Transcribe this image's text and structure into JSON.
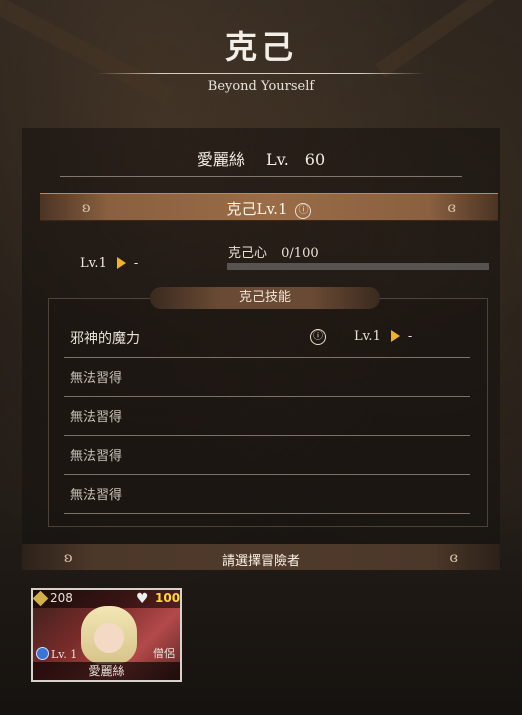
{
  "header": {
    "title": "克己",
    "subtitle": "Beyond Yourself"
  },
  "character": {
    "name": "愛麗絲",
    "level_label": "Lv.",
    "level": "60"
  },
  "transcend": {
    "title": "克己Lv.1",
    "current_level": "Lv.1",
    "next_level": "-",
    "heart_label": "克己心",
    "heart_value": "0/100",
    "progress_fraction": 0
  },
  "skills": {
    "header": "克己技能",
    "rows": [
      {
        "name": "邪神的魔力",
        "level": "Lv.1",
        "next": "-"
      },
      {
        "name": "無法習得"
      },
      {
        "name": "無法習得"
      },
      {
        "name": "無法習得"
      },
      {
        "name": "無法習得"
      }
    ]
  },
  "select_prompt": "請選擇冒險者",
  "card": {
    "attack": "208",
    "hp": "100",
    "level": "Lv. 1",
    "class": "僧侶",
    "name": "愛麗絲"
  },
  "icons": {
    "info": "ⓘ",
    "scroll": "scroll-ornament-icon",
    "arrow": "arrow-right-icon",
    "heart": "heart-icon",
    "sword": "sword-icon",
    "gem": "gem-icon"
  },
  "colors": {
    "accent": "#f2b225",
    "band": "#9a6c47",
    "hp": "#ffd835"
  }
}
